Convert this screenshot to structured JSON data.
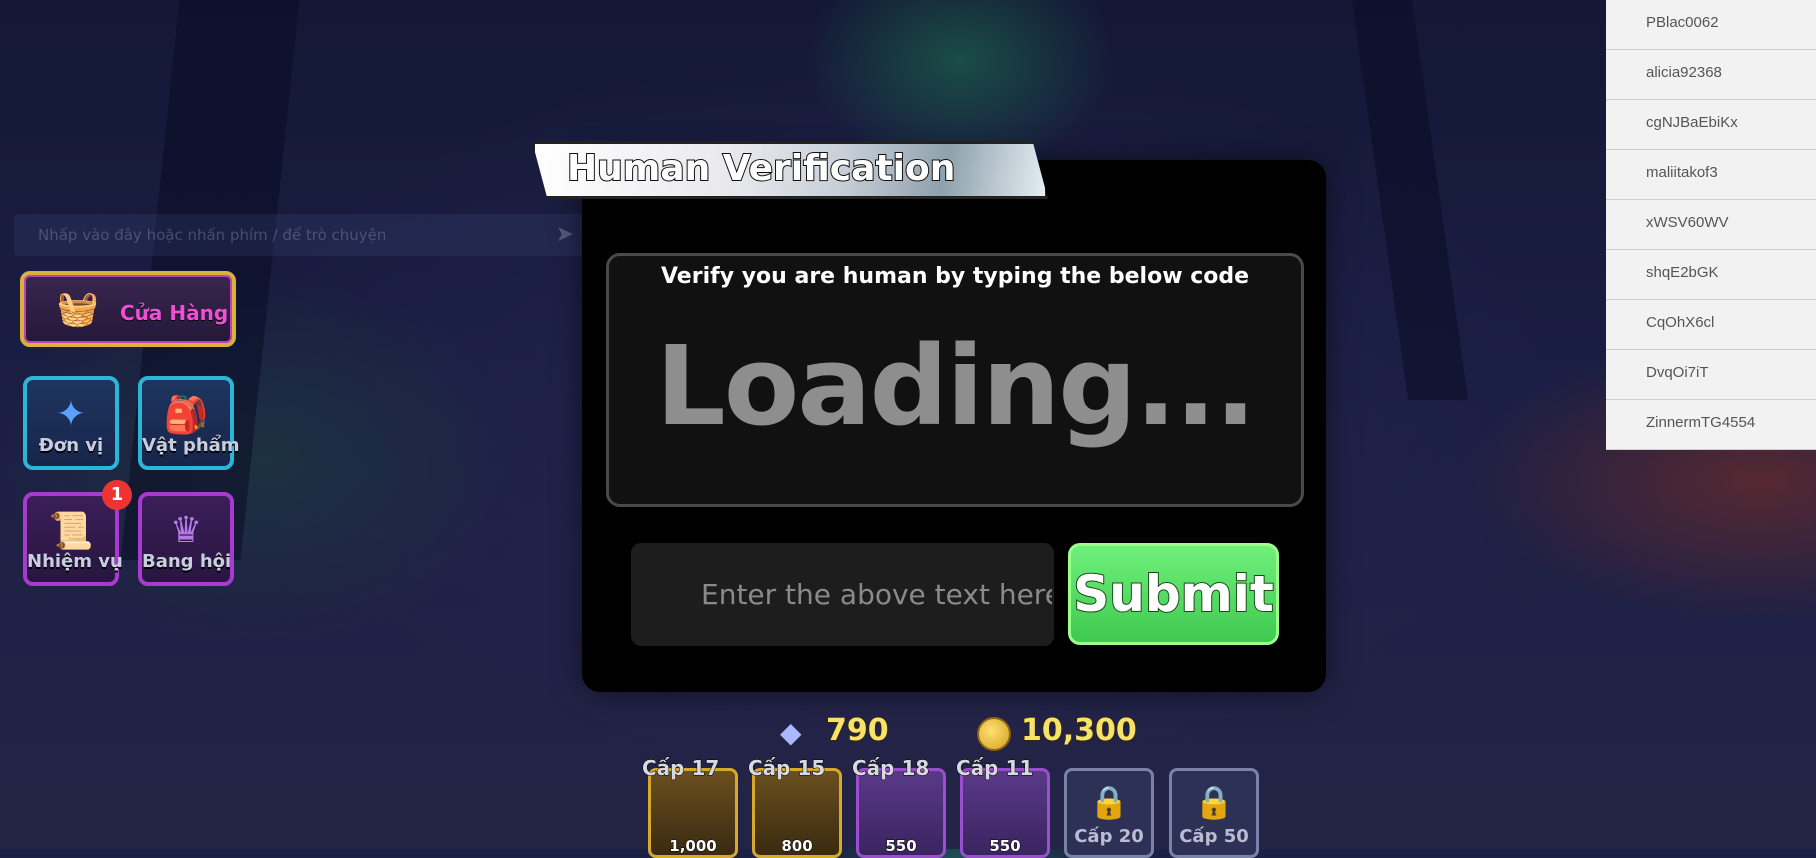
{
  "chat": {
    "placeholder": "Nhấp vào đây hoặc nhấn phím / để trò chuyện"
  },
  "menu": {
    "shop_label": "Cửa Hàng",
    "units_label": "Đơn vị",
    "items_label": "Vật phẩm",
    "quests_label": "Nhiệm vụ",
    "quests_badge": "1",
    "guild_label": "Bang hội"
  },
  "dialog": {
    "title": "Human Verification",
    "instruction": "Verify you are human by typing the below code",
    "code_text": "Loading...",
    "input_placeholder": "Enter the above text here",
    "submit_label": "Submit"
  },
  "player_list": [
    "PBlac0062",
    "alicia92368",
    "cgNJBaEbiKx",
    "maliitakof3",
    "xWSV60WV",
    "shqE2bGK",
    "CqOhX6cl",
    "DvqOi7iT",
    "ZinnermTG4554"
  ],
  "currency": {
    "gems": "790",
    "coins": "10,300"
  },
  "hotbar": [
    {
      "level": "Cấp 17",
      "cost": "1,000"
    },
    {
      "level": "Cấp 15",
      "cost": "800"
    },
    {
      "level": "Cấp 18",
      "cost": "550"
    },
    {
      "level": "Cấp 11",
      "cost": "550"
    },
    {
      "level": "Cấp 20",
      "cost": ""
    },
    {
      "level": "Cấp 50",
      "cost": ""
    }
  ]
}
